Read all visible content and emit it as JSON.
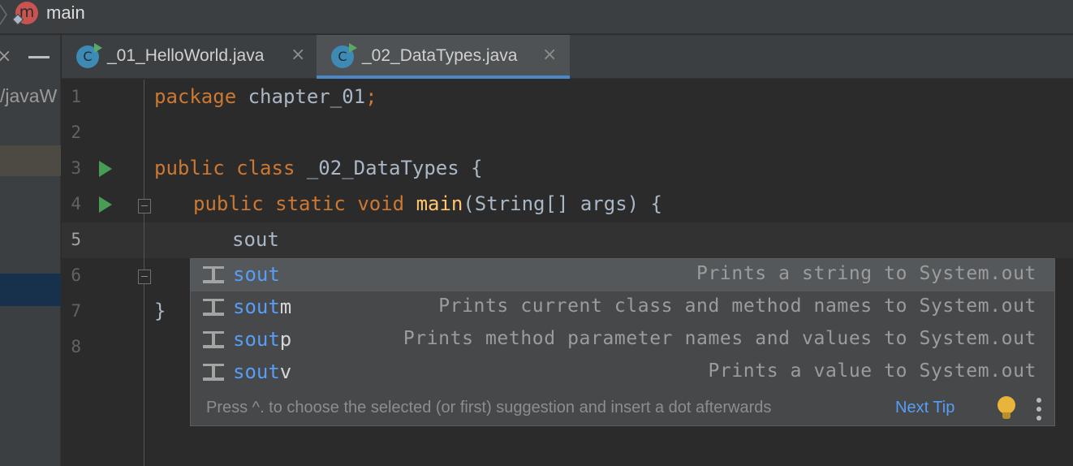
{
  "topbar": {
    "avatar_letter": "m",
    "branch": "main"
  },
  "project_panel": {
    "close_icon": "×",
    "path_fragment": "/javaW"
  },
  "tabs": [
    {
      "icon": "java-class-icon",
      "icon_letter": "C",
      "label": "_01_HelloWorld.java",
      "close": "×",
      "active": false
    },
    {
      "icon": "java-class-icon",
      "icon_letter": "C",
      "label": "_02_DataTypes.java",
      "close": "×",
      "active": true
    }
  ],
  "editor": {
    "line_numbers": [
      "1",
      "2",
      "3",
      "4",
      "5",
      "6",
      "7",
      "8"
    ],
    "current_line": "5",
    "lines": {
      "l1": {
        "kw": "package",
        "rest": " chapter_01",
        "semi": ";"
      },
      "l3": {
        "kw1": "public",
        "kw2": "class",
        "rest": " _02_DataTypes {"
      },
      "l4": {
        "kw1": "public",
        "kw2": "static",
        "kw3": "void",
        "fn": "main",
        "rest": "(String[] args) {"
      },
      "l5": {
        "text": "sout"
      },
      "l7": {
        "text": "}"
      }
    }
  },
  "completion": {
    "typed_prefix": "sout",
    "items": [
      {
        "match": "sout",
        "rest": "",
        "description": "Prints a string to System.out",
        "icon": "live-template-icon"
      },
      {
        "match": "sout",
        "rest": "m",
        "description": "Prints current class and method names to System.out",
        "icon": "live-template-icon"
      },
      {
        "match": "sout",
        "rest": "p",
        "description": "Prints method parameter names and values to System.out",
        "icon": "live-template-icon"
      },
      {
        "match": "sout",
        "rest": "v",
        "description": "Prints a value to System.out",
        "icon": "live-template-icon"
      }
    ],
    "hint": "Press ^. to choose the selected (or first) suggestion and insert a dot afterwards",
    "next_tip": "Next Tip"
  },
  "colors": {
    "keyword": "#cc7832",
    "function": "#ffc66d",
    "identifier": "#a9b7c6",
    "match_highlight": "#589df6",
    "run_gutter": "#499c54",
    "tab_underline": "#4a88c7"
  }
}
